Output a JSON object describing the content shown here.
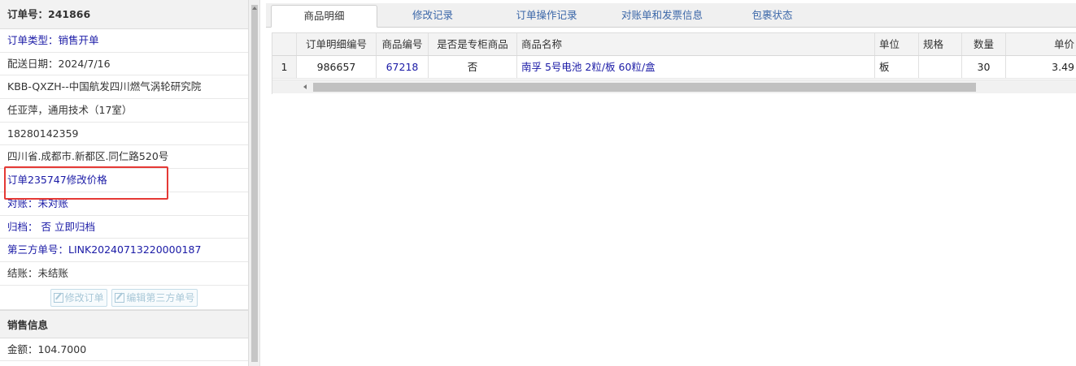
{
  "left_panel": {
    "order_header": "订单号：241866",
    "rows": [
      {
        "text": "订单类型：销售开单",
        "color": "blue"
      },
      {
        "text": "配送日期：2024/7/16",
        "color": "dark"
      },
      {
        "text": "KBB-QXZH--中国航发四川燃气涡轮研究院",
        "color": "dark"
      },
      {
        "text": "任亚萍，通用技术（17室）",
        "color": "dark"
      },
      {
        "text": "18280142359",
        "color": "dark"
      },
      {
        "text": "四川省.成都市.新都区.同仁路520号",
        "color": "dark"
      },
      {
        "text": "订单235747修改价格",
        "color": "blue"
      },
      {
        "text": "对账：未对账",
        "color": "blue"
      },
      {
        "text": "归档： 否 立即归档",
        "color": "blue"
      },
      {
        "text": "第三方单号：LINK20240713220000187",
        "color": "blue"
      },
      {
        "text": "结账：未结账",
        "color": "dark"
      }
    ],
    "buttons": {
      "modify_order": "修改订单",
      "edit_third_party": "编辑第三方单号"
    },
    "sales_section_title": "销售信息",
    "amount": "金额：104.7000"
  },
  "tabs": [
    {
      "label": "商品明细",
      "active": true
    },
    {
      "label": "修改记录",
      "active": false
    },
    {
      "label": "订单操作记录",
      "active": false
    },
    {
      "label": "对账单和发票信息",
      "active": false
    },
    {
      "label": "包裹状态",
      "active": false
    }
  ],
  "grid": {
    "columns": [
      "",
      "订单明细编号",
      "商品编号",
      "是否是专柜商品",
      "商品名称",
      "单位",
      "规格",
      "数量",
      "单价"
    ],
    "rows": [
      [
        "1",
        "986657",
        "67218",
        "否",
        "南孚 5号电池 2粒/板 60粒/盒",
        "板",
        "",
        "30",
        "3.49"
      ]
    ]
  },
  "colors": {
    "link": "#1a1aa6",
    "tab_link": "#3a66a8",
    "highlight_box": "#e53935"
  }
}
